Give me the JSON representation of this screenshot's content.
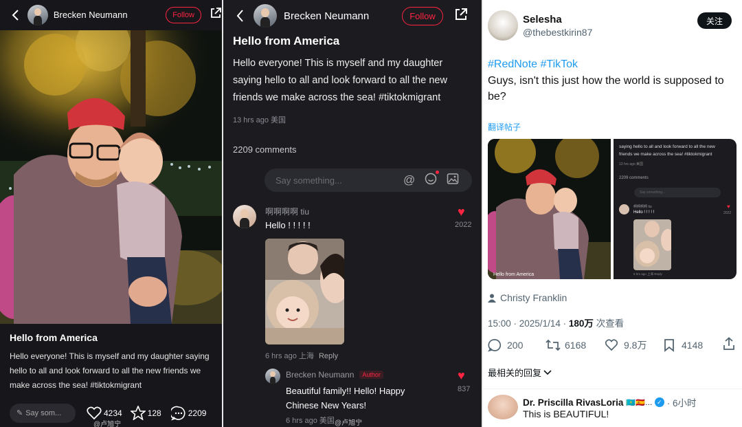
{
  "left_post": {
    "username": "Brecken Neumann",
    "follow_label": "Follow",
    "title": "Hello from America",
    "body": "Hello everyone! This is myself and my daughter saying hello to all and look forward to all the new friends we make across the sea!",
    "hashtag": "#tiktokmigrant",
    "comment_placeholder": "Say som...",
    "likes": "4234",
    "favorites": "128",
    "comments": "2209",
    "watermark": "@卢旭宁"
  },
  "middle_post": {
    "username": "Brecken Neumann",
    "follow_label": "Follow",
    "title": "Hello from America",
    "body": "Hello everyone! This is myself and my daughter saying hello to all and look forward to all the new friends we make across the sea!",
    "hashtag": "#tiktokmigrant",
    "time_location": "13 hrs ago 美国",
    "comments_count": "2209 comments",
    "comment_placeholder": "Say something...",
    "comment1": {
      "name": "啊啊啊啊 tiu",
      "text": "Hello ! ! ! ! !",
      "likes": "2022",
      "meta": "6 hrs ago 上海",
      "reply_label": "Reply"
    },
    "reply1": {
      "name": "Brecken Neumann",
      "badge": "Author",
      "text": "Beautiful family!! Hello! Happy Chinese New Years!",
      "likes": "837",
      "meta": "6 hrs ago 美国",
      "watermark": "@卢旭宁"
    }
  },
  "right_post": {
    "display_name": "Selesha",
    "handle": "@thebestkirin87",
    "follow_label": "关注",
    "hashtags": "#RedNote #TikTok",
    "text": "Guys, isn't this just how the world is supposed to be?",
    "translate": "翻译帖子",
    "embed_caption": "Hello from America",
    "mini_text1": "saying hello to all and look forward to all the new",
    "mini_text2": "friends we make across the sea!  #tiktokmigrant",
    "mini_time": "13 hrs ago 美国",
    "mini_comments": "2209 comments",
    "mini_say": "Say something...",
    "mini_comment_name": "啊啊啊啊 tiu",
    "mini_comment_text": "Hello ! ! ! ! !",
    "mini_comment_likes": "2022",
    "mini_reply_meta": "6 hrs ago 上海 Reply",
    "credit": "Christy Franklin",
    "time": "15:00 · 2025/1/14 · ",
    "views_num": "180万",
    "views_label": "次查看",
    "replies": "200",
    "retweets": "6168",
    "likes": "9.8万",
    "bookmarks": "4148",
    "sort_label": "最相关的回复",
    "reply_name": "Dr. Priscilla RivasLoria",
    "reply_flags": "🇰🇿🇪🇸…",
    "reply_time": "· 6小时",
    "reply_text": "This is BEAUTIFUL!"
  },
  "colors": {
    "red": "#ff2442",
    "twitter_blue": "#1d9bf0",
    "dark_bg": "#17171b"
  }
}
